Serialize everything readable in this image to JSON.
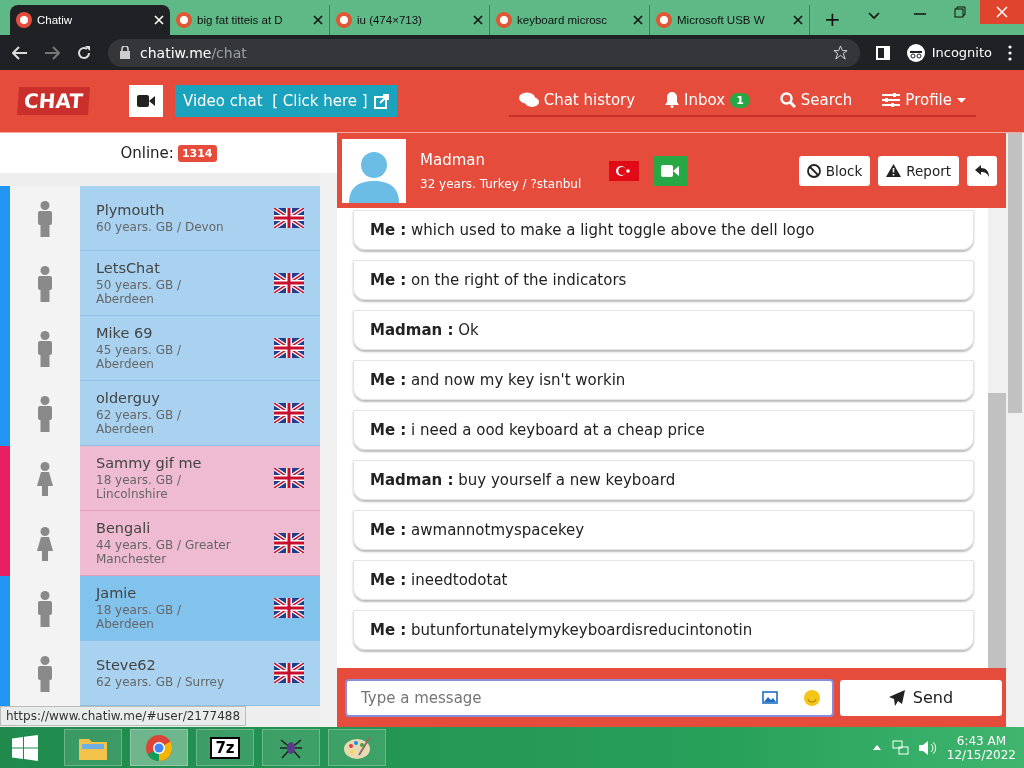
{
  "browser": {
    "tabs": [
      {
        "title": "Chatiw",
        "selected": true
      },
      {
        "title": "big fat titteis at D",
        "selected": false
      },
      {
        "title": "iu (474×713)",
        "selected": false
      },
      {
        "title": "keyboard microsc",
        "selected": false
      },
      {
        "title": "Microsoft USB W",
        "selected": false
      }
    ],
    "new_tab": "+",
    "url_host": "chatiw.me",
    "url_path": "/chat",
    "incognito": "Incognito"
  },
  "site": {
    "logo": "CHAT",
    "video_chat": "Video chat  [ Click here ]",
    "nav": [
      {
        "kind": "history",
        "label": "Chat history"
      },
      {
        "kind": "inbox",
        "label": "Inbox",
        "badge": "1"
      },
      {
        "kind": "search",
        "label": "Search"
      },
      {
        "kind": "profile",
        "label": "Profile"
      }
    ]
  },
  "online": {
    "label": "Online:",
    "count": "1314"
  },
  "users": [
    {
      "name": "Plymouth",
      "info": "60 years. GB / Devon",
      "kind": "male",
      "selected": false
    },
    {
      "name": "LetsChat",
      "info": "50 years. GB / Aberdeen",
      "kind": "male",
      "selected": false
    },
    {
      "name": "Mike 69",
      "info": "45 years. GB / Aberdeen",
      "kind": "male",
      "selected": false
    },
    {
      "name": "olderguy",
      "info": "62 years. GB / Aberdeen",
      "kind": "male",
      "selected": false
    },
    {
      "name": "Sammy gif me",
      "info": "18 years. GB / Lincolnshire",
      "kind": "female",
      "selected": false
    },
    {
      "name": "Bengali",
      "info": "44 years. GB / Greater Manchester",
      "kind": "female",
      "selected": false
    },
    {
      "name": "Jamie",
      "info": "18 years. GB / Aberdeen",
      "kind": "male",
      "selected": true
    },
    {
      "name": "Steve62",
      "info": "62 years. GB / Surrey",
      "kind": "male",
      "selected": false
    }
  ],
  "chat": {
    "name": "Madman",
    "info": "32 years. Turkey / ?stanbul",
    "block": "Block",
    "report": "Report",
    "messages": [
      "**Me :** which used to make a light toggle above the dell logo",
      "**Me :** on the right of the indicators",
      "**Madman :** Ok",
      "**Me :** and now my key isn't workin",
      "**Me :** i need a ood keyboard at a cheap price",
      "**Madman :** buy yourself a new keyboard",
      "**Me :** awmannotmyspacekey",
      "**Me :** ineedtodotat",
      "**Me :** butunfortunatelymykeyboardisreducintonotin"
    ],
    "input": {
      "placeholder": "Type a message"
    },
    "send": "Send"
  },
  "status_url": "https://www.chatiw.me/#user/2177488",
  "taskbar": {
    "apps": [
      {
        "kind": "folder",
        "selected": false
      },
      {
        "kind": "browser",
        "selected": true
      },
      {
        "kind": "archive",
        "label": "7z",
        "selected": false
      },
      {
        "kind": "spider",
        "selected": false
      },
      {
        "kind": "palette",
        "selected": false
      }
    ],
    "time": "6:43 AM",
    "date": "12/15/2022"
  }
}
